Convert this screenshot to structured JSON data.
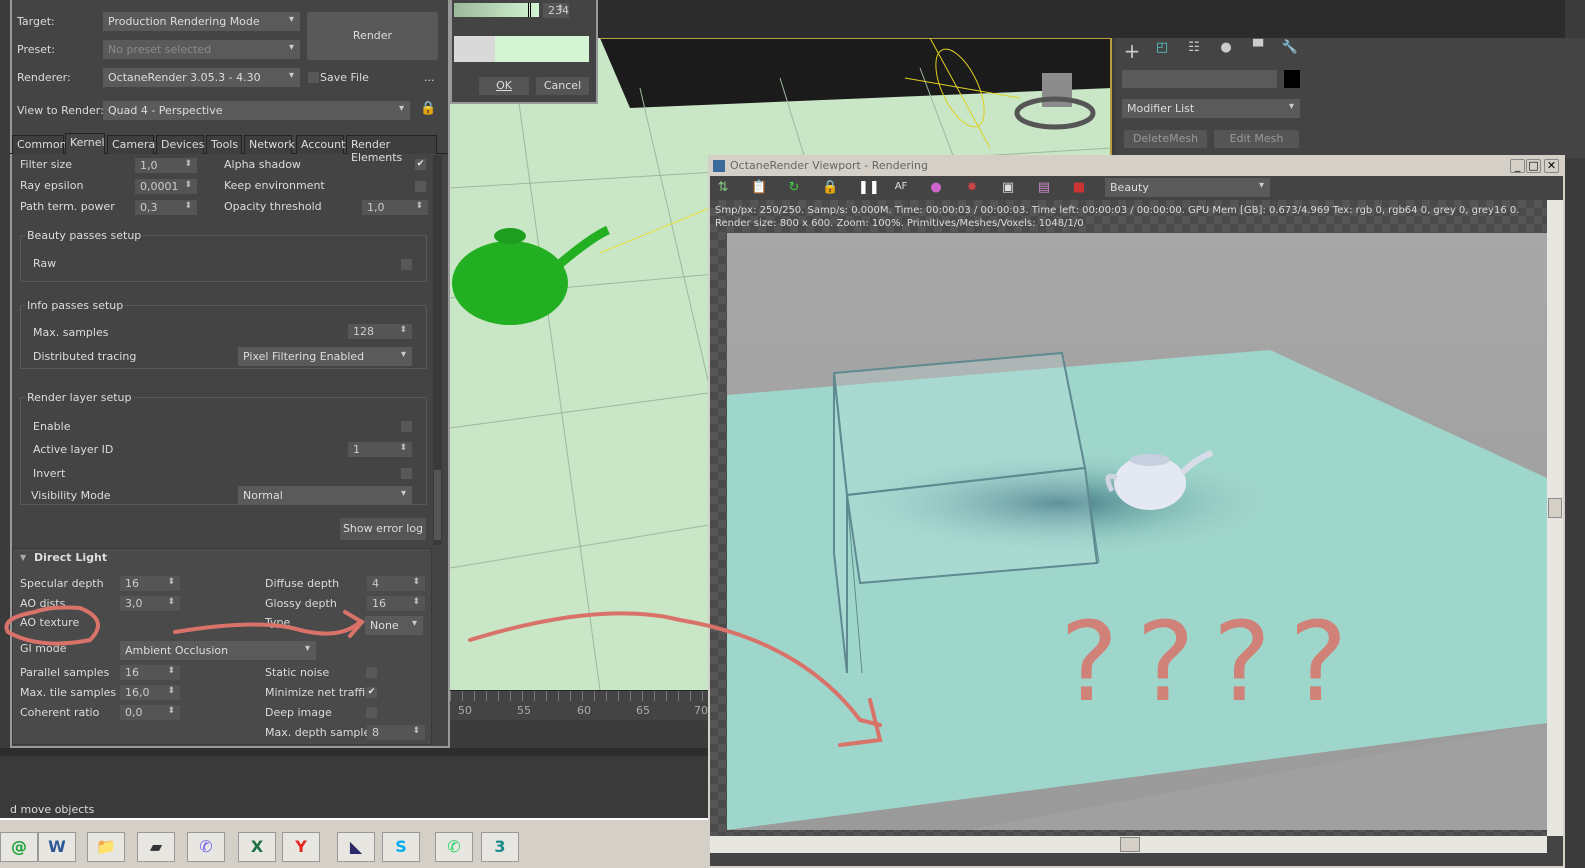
{
  "render_setup": {
    "target_label": "Target:",
    "target_value": "Production Rendering Mode",
    "preset_label": "Preset:",
    "preset_value": "No preset selected",
    "renderer_label": "Renderer:",
    "renderer_value": "OctaneRender 3.05.3 - 4.30",
    "save_file": "Save File",
    "more": "...",
    "render_button": "Render",
    "view_label": "View to Render:",
    "view_value": "Quad 4 - Perspective",
    "tabs": [
      "Common",
      "Kernel",
      "Camera",
      "Devices",
      "Tools",
      "Network",
      "Account",
      "Render Elements"
    ],
    "active_tab": "Kernel",
    "rows_top": [
      {
        "label": "Filter size",
        "value": "1,0",
        "label2": "Alpha shadow",
        "check2": true
      },
      {
        "label": "Ray epsilon",
        "value": "0,0001",
        "label2": "Keep environment",
        "check2": false
      },
      {
        "label": "Path term. power",
        "value": "0,3",
        "label2": "Opacity threshold",
        "value2": "1,0"
      }
    ],
    "beauty": {
      "title": "Beauty passes setup",
      "raw": "Raw",
      "raw_checked": false
    },
    "info": {
      "title": "Info passes setup",
      "max_samples_label": "Max. samples",
      "max_samples": "128",
      "dist_label": "Distributed tracing",
      "dist_value": "Pixel Filtering Enabled"
    },
    "layer": {
      "title": "Render layer setup",
      "enable": "Enable",
      "active_id_label": "Active layer ID",
      "active_id": "1",
      "invert": "Invert",
      "vis_label": "Visibility Mode",
      "vis_value": "Normal"
    },
    "show_error_log": "Show error log",
    "direct_light": {
      "title": "Direct Light",
      "specular_label": "Specular depth",
      "specular": "16",
      "diffuse_label": "Diffuse depth",
      "diffuse": "4",
      "ao_dists_label": "AO dists",
      "ao_dists": "3,0",
      "glossy_label": "Glossy depth",
      "glossy": "16",
      "ao_texture_label": "AO texture",
      "type_label": "Type",
      "type_value": "None",
      "gi_label": "GI mode",
      "gi_value": "Ambient Occlusion",
      "parallel_label": "Parallel samples",
      "parallel": "16",
      "static_noise": "Static noise",
      "static_noise_checked": false,
      "tile_label": "Max. tile samples",
      "tile": "16,0",
      "min_net": "Minimize net traffic",
      "min_net_checked": true,
      "coherent_label": "Coherent ratio",
      "coherent": "0,0",
      "deep_image": "Deep image",
      "deep_image_checked": false,
      "max_depth_label": "Max. depth samples",
      "max_depth": "8"
    }
  },
  "color_picker": {
    "value": "234",
    "ok": "OK",
    "cancel": "Cancel"
  },
  "timeline": {
    "ticks": [
      "50",
      "55",
      "60",
      "65",
      "70"
    ]
  },
  "status_text": "d move objects",
  "command_panel": {
    "modifier_list": "Modifier List",
    "delete_mesh": "DeleteMesh",
    "edit_mesh": "Edit Mesh",
    "tabs": [
      "create-icon",
      "modify-icon",
      "hierarchy-icon",
      "motion-icon",
      "display-icon",
      "utilities-icon"
    ]
  },
  "octane": {
    "title": "OctaneRender Viewport - Rendering",
    "pass": "Beauty",
    "stats1": "Smp/px: 250/250.   Samp/s: 0.000M.   Time: 00:00:03 / 00:00:03.   Time left: 00:00:03 / 00:00:00.   GPU Mem [GB]: 0.673/4.969   Tex: rgb 0, rgb64 0, grey 0, grey16 0.",
    "stats2": "Render size: 800 x 600.   Zoom: 100%.   Primitives/Meshes/Voxels: 1048/1/0",
    "annotation": "????"
  },
  "taskbar": [
    {
      "name": "mail-ru-agent-icon",
      "glyph": "@",
      "color": "#1aa33a"
    },
    {
      "name": "word-icon",
      "glyph": "W",
      "color": "#2b5797"
    },
    {
      "name": "file-explorer-icon",
      "glyph": "📁",
      "color": "#e8b84a"
    },
    {
      "name": "tablet-icon",
      "glyph": "▰",
      "color": "#333333"
    },
    {
      "name": "viber-icon",
      "glyph": "✆",
      "color": "#7360f2"
    },
    {
      "name": "excel-icon",
      "glyph": "X",
      "color": "#1e7145"
    },
    {
      "name": "yandex-browser-icon",
      "glyph": "Y",
      "color": "#e52620"
    },
    {
      "name": "media-encoder-icon",
      "glyph": "◣",
      "color": "#2a2a6a"
    },
    {
      "name": "skype-icon",
      "glyph": "S",
      "color": "#00aff0"
    },
    {
      "name": "whatsapp-icon",
      "glyph": "✆",
      "color": "#25d366"
    },
    {
      "name": "3ds-max-icon",
      "glyph": "3",
      "color": "#1a8a8a"
    }
  ],
  "colors": {
    "panel": "#444444",
    "viewport_ground": "#c9e6c6",
    "render_plane": "#9fd6cb",
    "annotation": "#d9736a",
    "teapot_viewport": "#22b022"
  }
}
